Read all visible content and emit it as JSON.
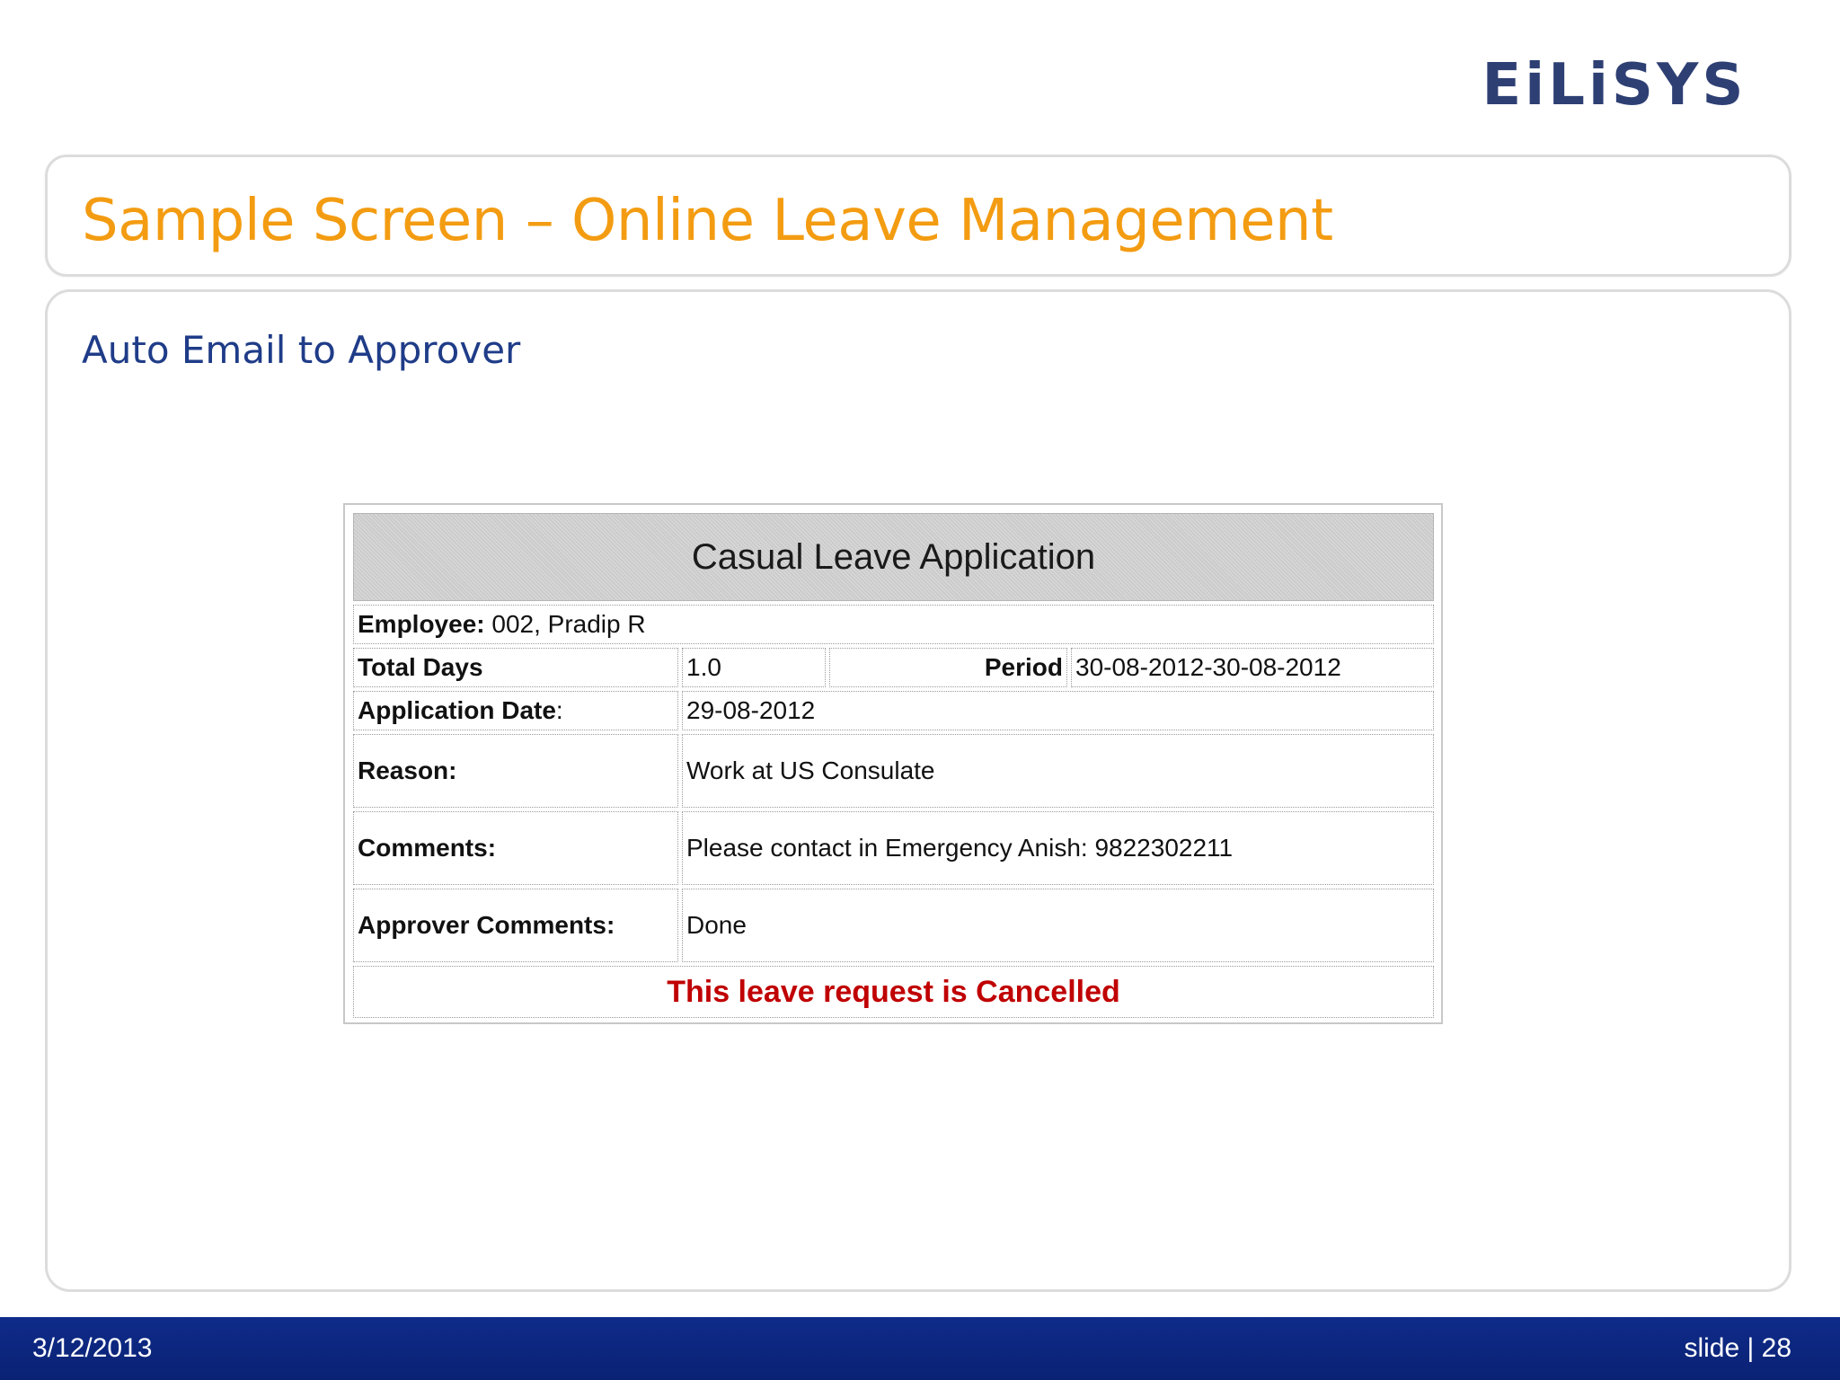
{
  "logo": {
    "text": "EiLiSYS",
    "color": "#2e3f73",
    "icon": "eilisys-logo"
  },
  "slide": {
    "title": "Sample Screen – Online Leave Management",
    "subtitle": "Auto Email to Approver"
  },
  "application": {
    "header": "Casual Leave Application",
    "employee_label": "Employee:",
    "employee_value": " 002, Pradip R",
    "total_days_label": "Total Days",
    "total_days_value": "1.0",
    "period_label": "Period",
    "period_value": "30-08-2012-30-08-2012",
    "application_date_label": "Application Date",
    "application_date_colon": ":",
    "application_date_value": "29-08-2012",
    "reason_label": "Reason:",
    "reason_value": "Work at US Consulate",
    "comments_label": "Comments:",
    "comments_value": "Please contact in Emergency Anish: 9822302211",
    "approver_comments_label": "Approver Comments:",
    "approver_comments_value": "Done",
    "status_text": "This leave request is Cancelled",
    "status_color": "#c00000"
  },
  "footer": {
    "date": "3/12/2013",
    "slide_label": "slide | 28",
    "background_color": "#0f2b8a"
  },
  "colors": {
    "title_color": "#f39c12",
    "subtitle_color": "#1f3c88"
  }
}
